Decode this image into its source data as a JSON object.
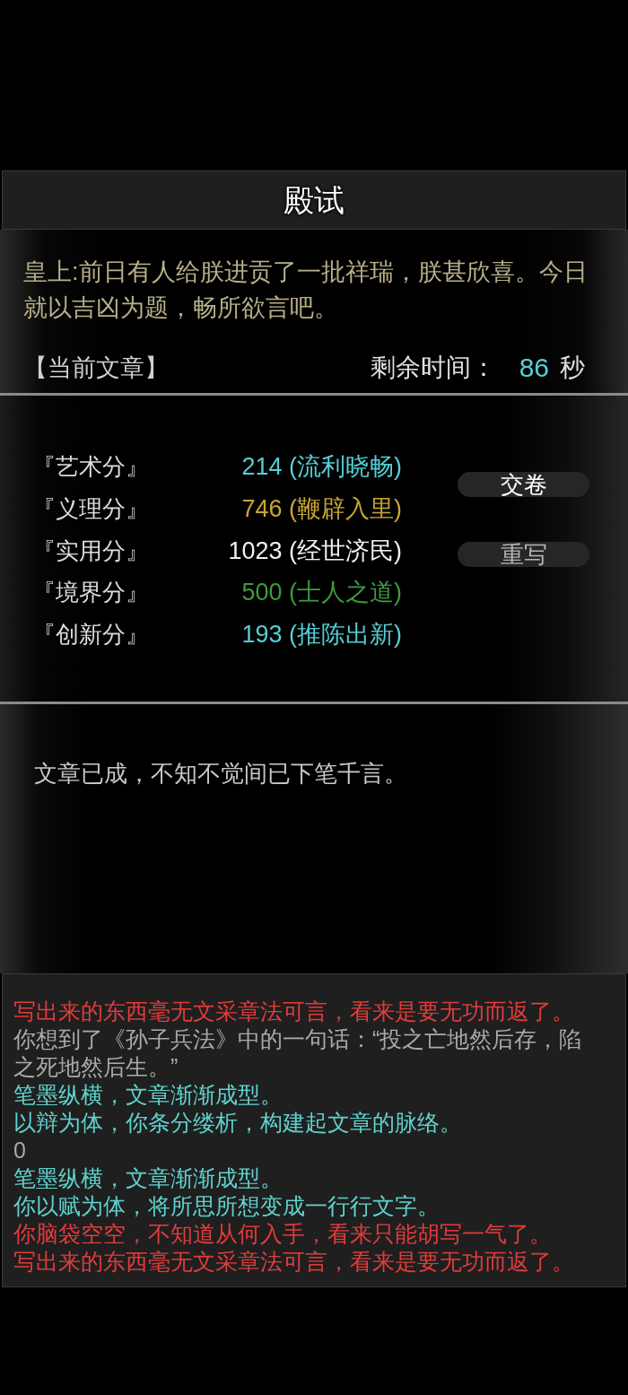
{
  "title": "殿试",
  "prompt": {
    "text": "皇上:前日有人给朕进贡了一批祥瑞，朕甚欣喜。今日就以吉凶为题，畅所欲言吧。"
  },
  "essay_header": {
    "label": "【当前文章】",
    "timer_label": "剩余时间：",
    "timer_value": "86",
    "timer_unit": "秒"
  },
  "scores": [
    {
      "label": "『艺术分』",
      "value": "214 (流利晓畅)",
      "color": "#55cfd6"
    },
    {
      "label": "『义理分』",
      "value": "746 (鞭辟入里)",
      "color": "#c9a633"
    },
    {
      "label": "『实用分』",
      "value": "1023 (经世济民)",
      "color": "#f0f0f0"
    },
    {
      "label": "『境界分』",
      "value": "500 (士人之道)",
      "color": "#3d9a3f"
    },
    {
      "label": "『创新分』",
      "value": "193 (推陈出新)",
      "color": "#55cfd6"
    }
  ],
  "buttons": [
    {
      "label": "交卷",
      "disabled": false
    },
    {
      "label": "重写",
      "disabled": true
    }
  ],
  "status_text": "文章已成，不知不觉间已下笔千言。",
  "log": [
    {
      "text": "写出来的东西毫无文采章法可言，看来是要无功而返了。",
      "color": "#e33b3b"
    },
    {
      "text": "你想到了《孙子兵法》中的一句话：“投之亡地然后存，陷之死地然后生。”",
      "color": "#aaaaaa"
    },
    {
      "text": "笔墨纵横，文章渐渐成型。",
      "color": "#5fd3cf"
    },
    {
      "text": "以辩为体，你条分缕析，构建起文章的脉络。",
      "color": "#5fd3cf"
    },
    {
      "text": "0",
      "color": "#aaaaaa"
    },
    {
      "text": "笔墨纵横，文章渐渐成型。",
      "color": "#5fd3cf"
    },
    {
      "text": "你以赋为体，将所思所想变成一行行文字。",
      "color": "#5fd3cf"
    },
    {
      "text": "你脑袋空空，不知道从何入手，看来只能胡写一气了。",
      "color": "#e33b3b"
    },
    {
      "text": "写出来的东西毫无文采章法可言，看来是要无功而返了。",
      "color": "#e33b3b"
    }
  ]
}
